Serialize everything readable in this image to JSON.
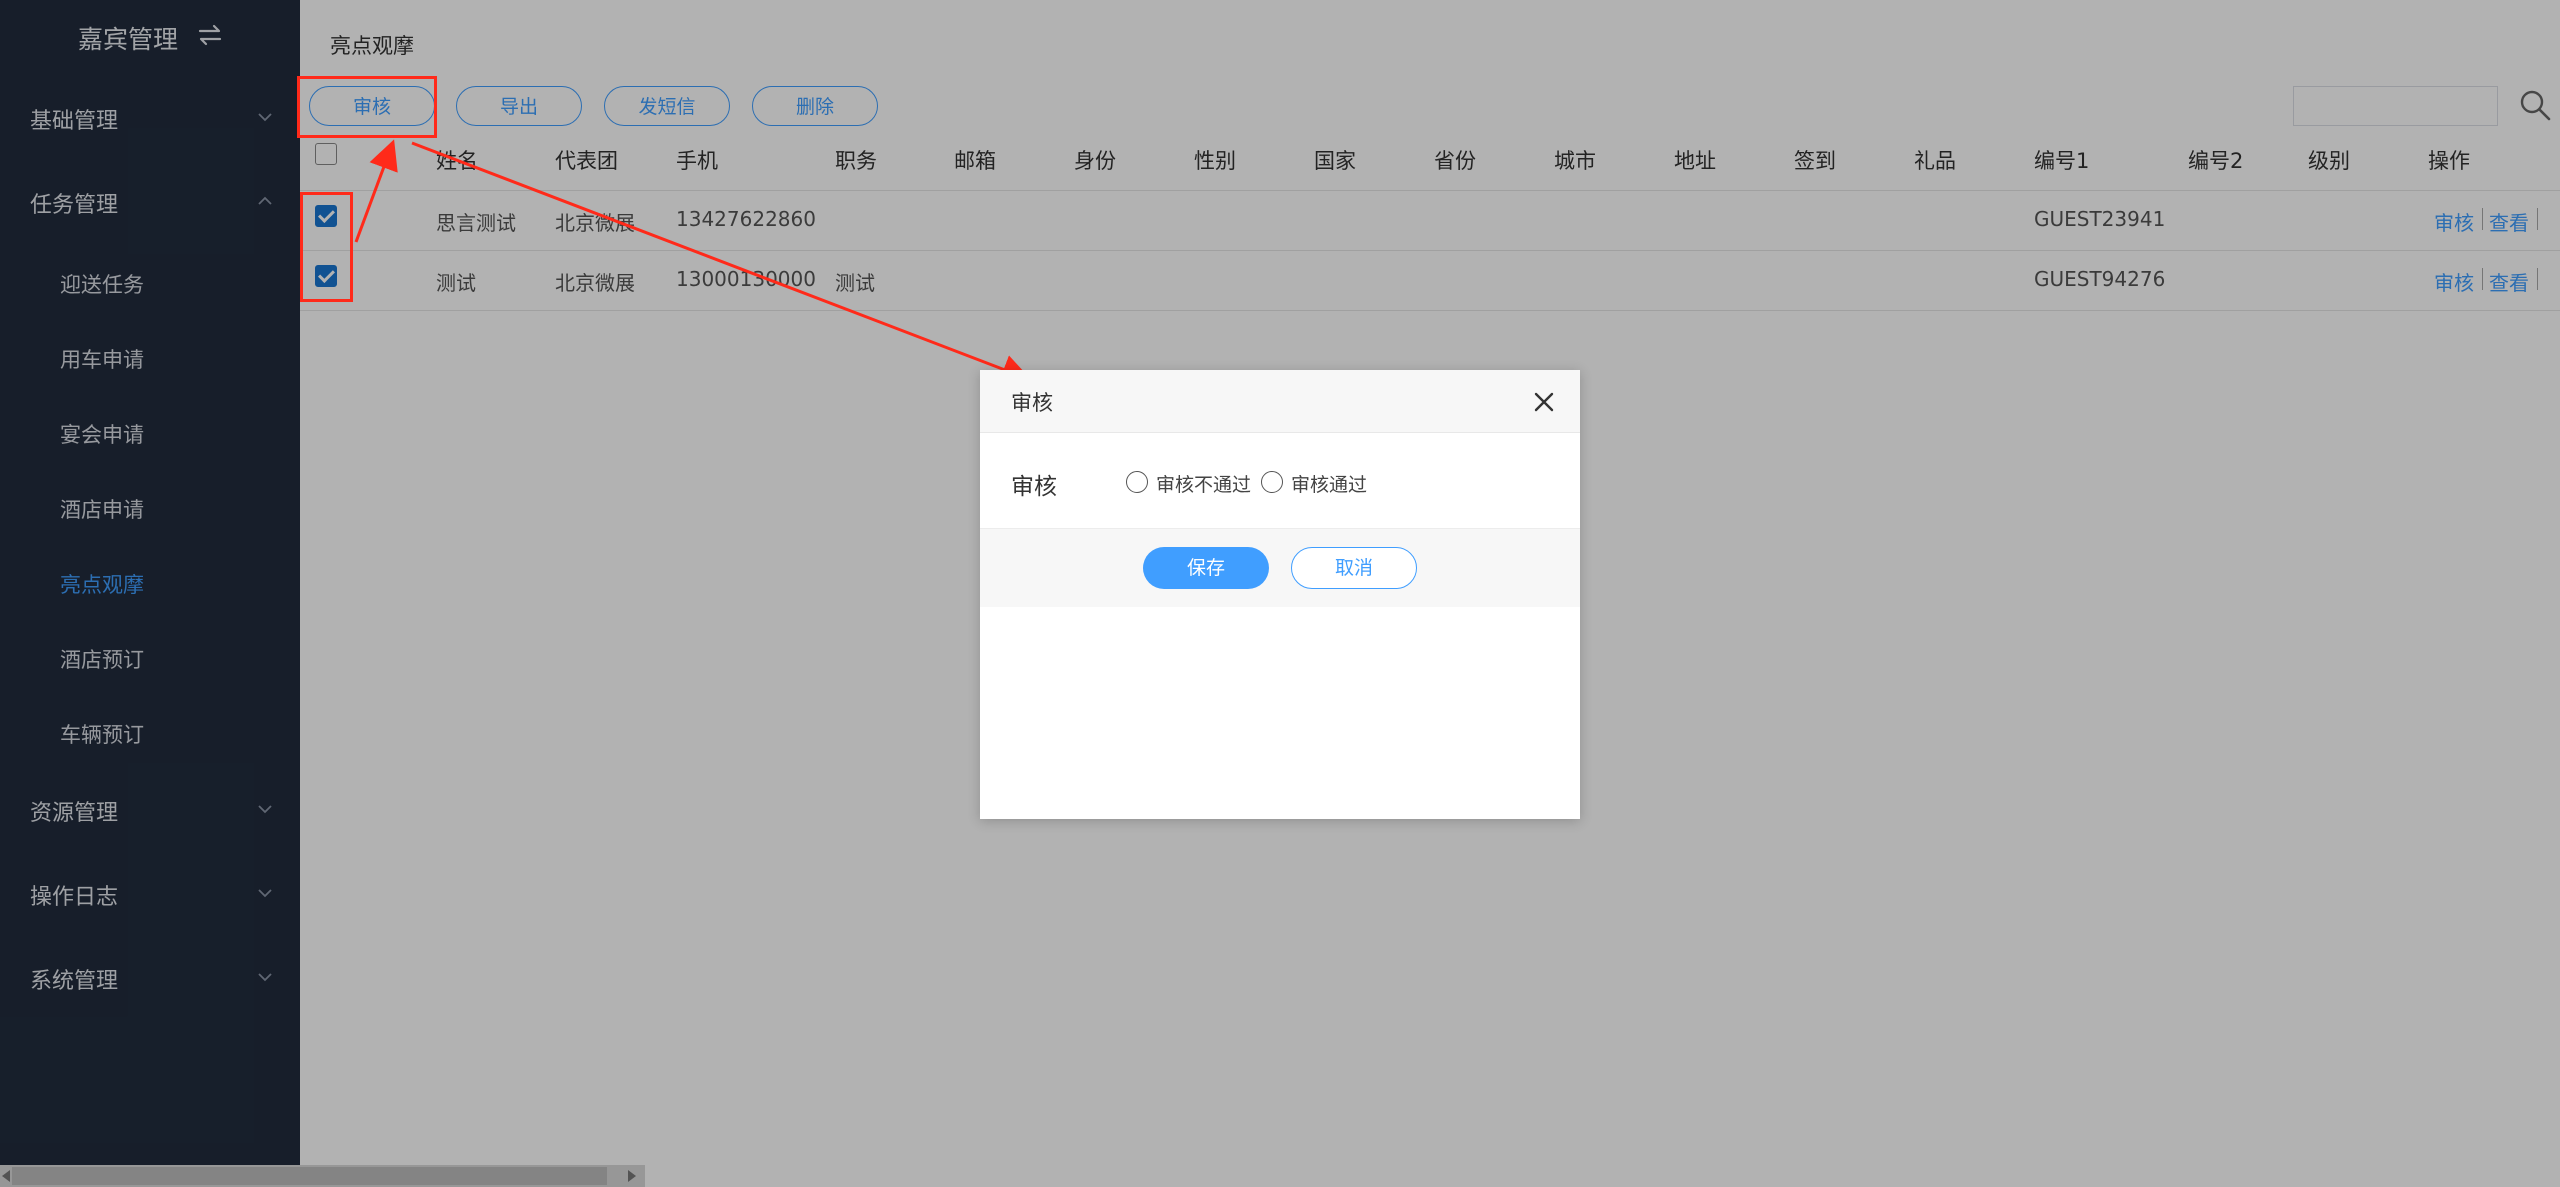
{
  "sidebar": {
    "title": "嘉宾管理",
    "groups": {
      "basic": "基础管理",
      "task": "任务管理",
      "resource": "资源管理",
      "oplog": "操作日志",
      "system": "系统管理"
    },
    "items": [
      "迎送任务",
      "用车申请",
      "宴会申请",
      "酒店申请",
      "亮点观摩",
      "酒店预订",
      "车辆预订"
    ],
    "active_item": "亮点观摩"
  },
  "main": {
    "breadcrumb": "亮点观摩",
    "toolbar": {
      "audit": "审核",
      "export": "导出",
      "sms": "发短信",
      "delete": "删除"
    },
    "search": {
      "value": ""
    },
    "columns": [
      "姓名",
      "代表团",
      "手机",
      "职务",
      "邮箱",
      "身份",
      "性别",
      "国家",
      "省份",
      "城市",
      "地址",
      "签到",
      "礼品",
      "编号1",
      "编号2",
      "级别",
      "操作"
    ],
    "rows": [
      {
        "name": "思言测试",
        "delegation": "北京微展",
        "phone": "13427622860",
        "position": "",
        "code1": "GUEST23941",
        "checked": true
      },
      {
        "name": "测试",
        "delegation": "北京微展",
        "phone": "13000130000",
        "position": "测试",
        "code1": "GUEST94276",
        "checked": true
      }
    ],
    "row_actions": {
      "audit": "审核",
      "view": "查看"
    }
  },
  "dialog": {
    "title": "审核",
    "field_label": "审核",
    "options": [
      "审核不通过",
      "审核通过"
    ],
    "save": "保存",
    "cancel": "取消"
  },
  "colors": {
    "accent": "#409eff",
    "sidebar_bg": "#212c3d",
    "annotation": "#ff2a1a"
  }
}
